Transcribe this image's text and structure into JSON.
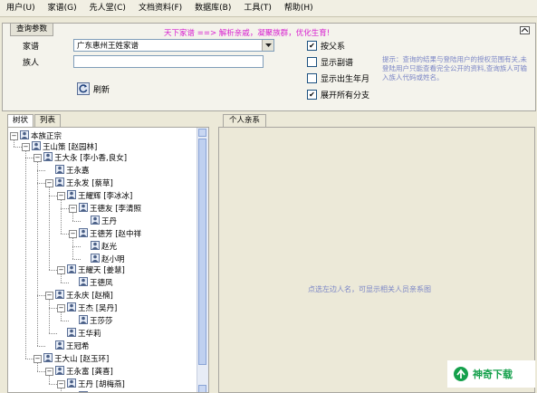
{
  "menubar": {
    "items": [
      "用户(U)",
      "家谱(G)",
      "先人堂(C)",
      "文档资料(F)",
      "数据库(B)",
      "工具(T)",
      "帮助(H)"
    ]
  },
  "query": {
    "group_title": "查询参数",
    "banner": "天下家谱 ==> 解析亲戚，凝聚族群，优化生育!",
    "jiapu_label": "家谱",
    "jiapu_value": "广东惠州王姓家谱",
    "zuren_label": "族人",
    "zuren_value": "",
    "refresh_label": "刷新",
    "options": [
      {
        "label": "按父系",
        "checked": true
      },
      {
        "label": "显示副谱",
        "checked": false
      },
      {
        "label": "显示出生年月",
        "checked": false
      },
      {
        "label": "展开所有分支",
        "checked": true
      }
    ],
    "hint": "提示：查询的结果与登陆用户的授权范围有关,未登陆用户只能查看完全公开的资料,查询族人可输入族人代码或姓名。"
  },
  "left_tabs": [
    "树状",
    "列表"
  ],
  "tree": {
    "nodes": [
      {
        "text": "本族正宗"
      },
      {
        "text": "王山策 [赵园林]"
      },
      {
        "text": "王大永 [李小香,良女]"
      },
      {
        "text": "王永嘉"
      },
      {
        "text": "王永发 [蔡草]"
      },
      {
        "text": "王耀辉 [李冰冰]"
      },
      {
        "text": "王德友 [李清照"
      },
      {
        "text": "王丹"
      },
      {
        "text": "王德芳 [赵中祥"
      },
      {
        "text": "赵光"
      },
      {
        "text": "赵小明"
      },
      {
        "text": "王耀天 [姜慧]"
      },
      {
        "text": "王德凤"
      },
      {
        "text": "王永庆 [赵楠]"
      },
      {
        "text": "王杰 [吴丹]"
      },
      {
        "text": "王莎莎"
      },
      {
        "text": "王华莉"
      },
      {
        "text": "王冠希"
      },
      {
        "text": "王大山 [赵玉环]"
      },
      {
        "text": "王永富 [龚喜]"
      },
      {
        "text": "王丹 [胡梅燕]"
      },
      {
        "text": "王小丫"
      }
    ]
  },
  "relation": {
    "tab_label": "个人亲系",
    "hint": "点选左边人名，可显示相关人员亲系图"
  },
  "watermark": {
    "text": "神奇下载"
  },
  "colors": {
    "banner": "#d81fd0",
    "hint": "#7b86c6",
    "watermark": "#14a04b"
  }
}
